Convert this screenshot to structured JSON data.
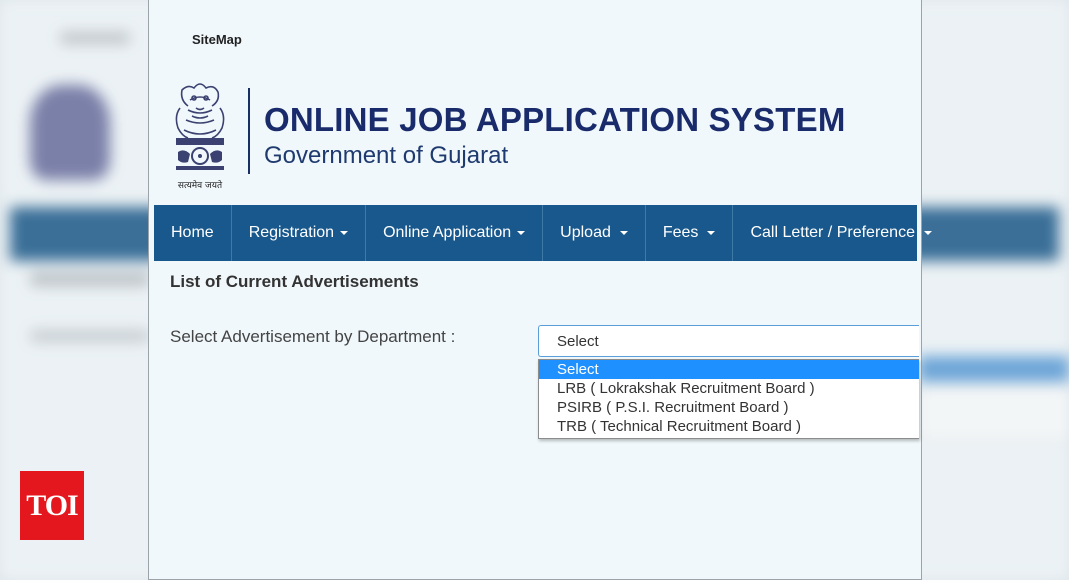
{
  "header": {
    "sitemap_link": "SiteMap",
    "title": "ONLINE JOB APPLICATION SYSTEM",
    "subtitle": "Government of Gujarat",
    "emblem_motto": "सत्यमेव जयते"
  },
  "nav": {
    "items": [
      {
        "label": "Home",
        "has_caret": false
      },
      {
        "label": "Registration",
        "has_caret": true
      },
      {
        "label": "Online Application",
        "has_caret": true
      },
      {
        "label": "Upload",
        "has_caret": true
      },
      {
        "label": "Fees",
        "has_caret": true
      },
      {
        "label": "Call Letter / Preference",
        "has_caret": true
      }
    ]
  },
  "main": {
    "heading": "List of Current Advertisements",
    "department_label": "Select Advertisement by Department :",
    "department_select": {
      "value": "Select",
      "options": [
        "Select",
        "LRB ( Lokrakshak Recruitment Board )",
        "PSIRB ( P.S.I. Recruitment Board )",
        "TRB ( Technical Recruitment Board )"
      ],
      "highlighted_option": "Select"
    }
  },
  "watermark": {
    "logo_text": "TOI"
  },
  "colors": {
    "nav_bg": "#19588c",
    "title": "#1a2b6b",
    "page_bg": "#f0f8fb",
    "option_highlight": "#1e90ff",
    "watermark_bg": "#e3171d"
  },
  "icons": {
    "emblem": "state-emblem-icon",
    "caret": "caret-down-icon"
  }
}
